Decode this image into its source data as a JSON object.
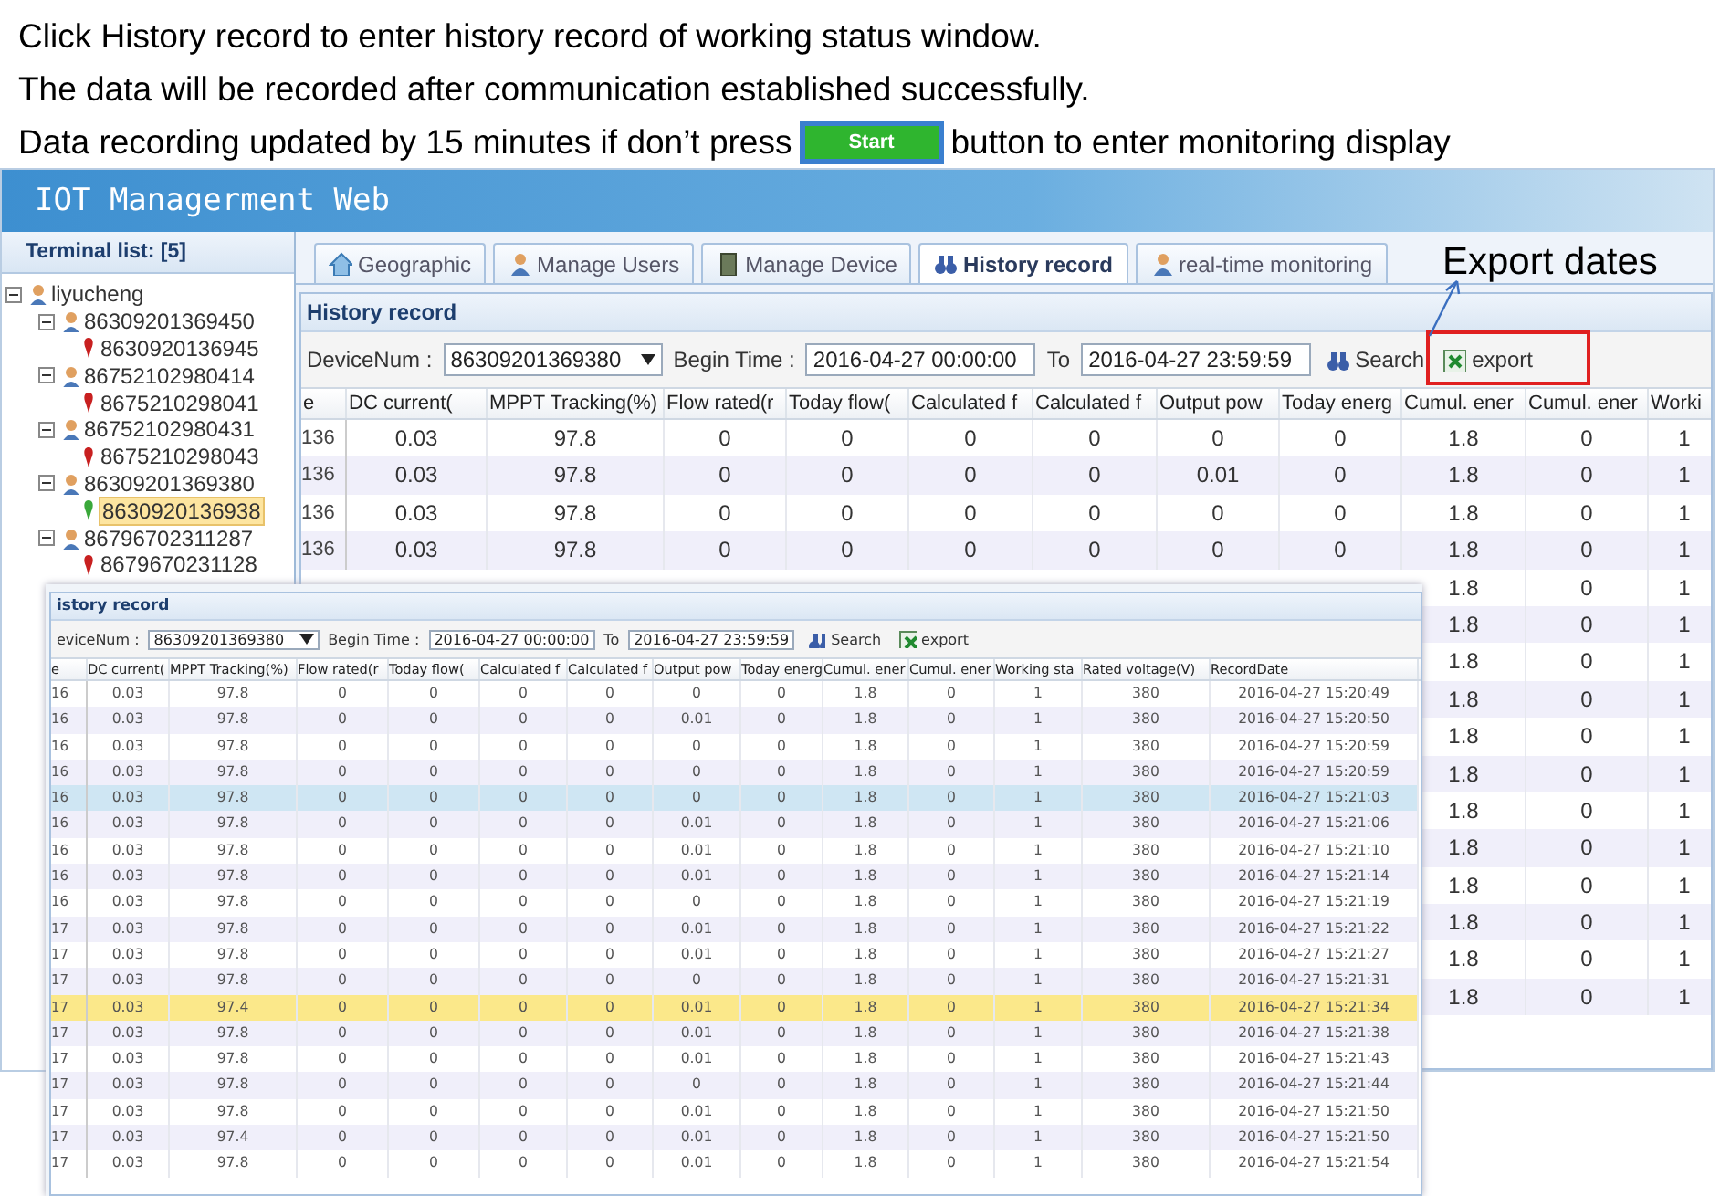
{
  "instructions": [
    {
      "kind": "text",
      "text": "Click History record to enter history record of working status window."
    },
    {
      "kind": "text",
      "text": "The data will be recorded after communication established successfully."
    },
    {
      "kind": "button-line",
      "text": "Data recording updated by 15 minutes if don’t press",
      "button": "Start",
      "after": "button to enter monitoring display"
    }
  ],
  "app": {
    "title": "IOT Managerment Web",
    "sidebar": {
      "title": "Terminal list: [5]",
      "tree": [
        {
          "label": "liyucheng",
          "expanded": true,
          "children": [
            {
              "label": "86309201369450",
              "expanded": true,
              "children": [
                {
                  "label": "8630920136945",
                  "selected": false
                }
              ]
            },
            {
              "label": "86752102980414",
              "expanded": true,
              "children": [
                {
                  "label": "8675210298041",
                  "selected": false
                }
              ]
            },
            {
              "label": "86752102980431",
              "expanded": true,
              "children": [
                {
                  "label": "8675210298043",
                  "selected": false
                }
              ]
            },
            {
              "label": "86309201369380",
              "expanded": true,
              "children": [
                {
                  "label": "8630920136938",
                  "selected": true
                }
              ]
            },
            {
              "label": "86796702311287",
              "expanded": true,
              "children": [
                {
                  "label": "8679670231128",
                  "selected": false
                }
              ]
            }
          ]
        }
      ]
    },
    "tabs": [
      {
        "label": "Geographic",
        "selected": false
      },
      {
        "label": "Manage Users",
        "selected": false
      },
      {
        "label": "Manage Device",
        "selected": false
      },
      {
        "label": "History record",
        "selected": true
      },
      {
        "label": "real-time monitoring",
        "selected": false
      }
    ],
    "panel": {
      "title": "History record",
      "device_label": "DeviceNum :",
      "device": "86309201369380",
      "begin_label": "Begin Time :",
      "begin": "2016-04-27 00:00:00",
      "to_label": "To",
      "end": "2016-04-27 23:59:59",
      "search": "Search",
      "export": "export",
      "columns": [
        "e",
        "DC current(",
        "MPPT Tracking(%)",
        "Flow rated(r",
        "Today flow(",
        "Calculated f",
        "Calculated f",
        "Output pow",
        "Today energ",
        "Cumul. ener",
        "Cumul. ener",
        "Worki"
      ],
      "rows": [
        {
          "selected": false,
          "cells": [
            "136",
            "0.03",
            "97.8",
            "0",
            "0",
            "0",
            "0",
            "0",
            "0",
            "1.8",
            "0",
            "1"
          ]
        },
        {
          "selected": false,
          "cells": [
            "136",
            "0.03",
            "97.8",
            "0",
            "0",
            "0",
            "0",
            "0.01",
            "0",
            "1.8",
            "0",
            "1"
          ]
        },
        {
          "selected": false,
          "cells": [
            "136",
            "0.03",
            "97.8",
            "0",
            "0",
            "0",
            "0",
            "0",
            "0",
            "1.8",
            "0",
            "1"
          ]
        },
        {
          "selected": false,
          "cells": [
            "136",
            "0.03",
            "97.8",
            "0",
            "0",
            "0",
            "0",
            "0",
            "0",
            "1.8",
            "0",
            "1"
          ]
        },
        {
          "selected": false,
          "cells": [
            "1.8",
            "0",
            "1"
          ]
        },
        {
          "selected": false,
          "cells": [
            "1.8",
            "0",
            "1"
          ]
        },
        {
          "selected": false,
          "cells": [
            "1.8",
            "0",
            "1"
          ]
        },
        {
          "selected": false,
          "cells": [
            "1.8",
            "0",
            "1"
          ]
        },
        {
          "selected": false,
          "cells": [
            "1.8",
            "0",
            "1"
          ]
        },
        {
          "selected": false,
          "cells": [
            "1.8",
            "0",
            "1"
          ]
        },
        {
          "selected": false,
          "cells": [
            "1.8",
            "0",
            "1"
          ]
        },
        {
          "selected": false,
          "cells": [
            "1.8",
            "0",
            "1"
          ]
        },
        {
          "selected": false,
          "cells": [
            "1.8",
            "0",
            "1"
          ]
        },
        {
          "selected": false,
          "cells": [
            "1.8",
            "0",
            "1"
          ]
        },
        {
          "selected": false,
          "cells": [
            "1.8",
            "0",
            "1"
          ]
        },
        {
          "selected": false,
          "cells": [
            "1.8",
            "0",
            "1"
          ]
        }
      ]
    }
  },
  "annotation": {
    "text": "Export dates"
  },
  "inset": {
    "title": "istory record",
    "device_label": "eviceNum :",
    "device": "86309201369380",
    "begin_label": "Begin Time :",
    "begin": "2016-04-27 00:00:00",
    "to_label": "To",
    "end": "2016-04-27 23:59:59",
    "search": "Search",
    "export": "export",
    "columns": [
      "e",
      "DC current(",
      "MPPT Tracking(%)",
      "Flow rated(r",
      "Today flow(",
      "Calculated f",
      "Calculated f",
      "Output pow",
      "Today energ",
      "Cumul. ener",
      "Cumul. ener",
      "Working sta",
      "Rated voltage(V)",
      "RecordDate"
    ],
    "rows": [
      {
        "selected": false,
        "highlighted": false,
        "cells": [
          "16",
          "0.03",
          "97.8",
          "0",
          "0",
          "0",
          "0",
          "0",
          "0",
          "1.8",
          "0",
          "1",
          "380",
          "2016-04-27 15:20:49"
        ]
      },
      {
        "selected": false,
        "highlighted": false,
        "cells": [
          "16",
          "0.03",
          "97.8",
          "0",
          "0",
          "0",
          "0",
          "0.01",
          "0",
          "1.8",
          "0",
          "1",
          "380",
          "2016-04-27 15:20:50"
        ]
      },
      {
        "selected": false,
        "highlighted": false,
        "cells": [
          "16",
          "0.03",
          "97.8",
          "0",
          "0",
          "0",
          "0",
          "0",
          "0",
          "1.8",
          "0",
          "1",
          "380",
          "2016-04-27 15:20:59"
        ]
      },
      {
        "selected": false,
        "highlighted": false,
        "cells": [
          "16",
          "0.03",
          "97.8",
          "0",
          "0",
          "0",
          "0",
          "0",
          "0",
          "1.8",
          "0",
          "1",
          "380",
          "2016-04-27 15:20:59"
        ]
      },
      {
        "selected": true,
        "highlighted": false,
        "cells": [
          "16",
          "0.03",
          "97.8",
          "0",
          "0",
          "0",
          "0",
          "0",
          "0",
          "1.8",
          "0",
          "1",
          "380",
          "2016-04-27 15:21:03"
        ]
      },
      {
        "selected": false,
        "highlighted": false,
        "cells": [
          "16",
          "0.03",
          "97.8",
          "0",
          "0",
          "0",
          "0",
          "0.01",
          "0",
          "1.8",
          "0",
          "1",
          "380",
          "2016-04-27 15:21:06"
        ]
      },
      {
        "selected": false,
        "highlighted": false,
        "cells": [
          "16",
          "0.03",
          "97.8",
          "0",
          "0",
          "0",
          "0",
          "0.01",
          "0",
          "1.8",
          "0",
          "1",
          "380",
          "2016-04-27 15:21:10"
        ]
      },
      {
        "selected": false,
        "highlighted": false,
        "cells": [
          "16",
          "0.03",
          "97.8",
          "0",
          "0",
          "0",
          "0",
          "0.01",
          "0",
          "1.8",
          "0",
          "1",
          "380",
          "2016-04-27 15:21:14"
        ]
      },
      {
        "selected": false,
        "highlighted": false,
        "cells": [
          "16",
          "0.03",
          "97.8",
          "0",
          "0",
          "0",
          "0",
          "0",
          "0",
          "1.8",
          "0",
          "1",
          "380",
          "2016-04-27 15:21:19"
        ]
      },
      {
        "selected": false,
        "highlighted": false,
        "cells": [
          "17",
          "0.03",
          "97.8",
          "0",
          "0",
          "0",
          "0",
          "0.01",
          "0",
          "1.8",
          "0",
          "1",
          "380",
          "2016-04-27 15:21:22"
        ]
      },
      {
        "selected": false,
        "highlighted": false,
        "cells": [
          "17",
          "0.03",
          "97.8",
          "0",
          "0",
          "0",
          "0",
          "0.01",
          "0",
          "1.8",
          "0",
          "1",
          "380",
          "2016-04-27 15:21:27"
        ]
      },
      {
        "selected": false,
        "highlighted": false,
        "cells": [
          "17",
          "0.03",
          "97.8",
          "0",
          "0",
          "0",
          "0",
          "0",
          "0",
          "1.8",
          "0",
          "1",
          "380",
          "2016-04-27 15:21:31"
        ]
      },
      {
        "selected": false,
        "highlighted": true,
        "cells": [
          "17",
          "0.03",
          "97.4",
          "0",
          "0",
          "0",
          "0",
          "0.01",
          "0",
          "1.8",
          "0",
          "1",
          "380",
          "2016-04-27 15:21:34"
        ]
      },
      {
        "selected": false,
        "highlighted": false,
        "cells": [
          "17",
          "0.03",
          "97.8",
          "0",
          "0",
          "0",
          "0",
          "0.01",
          "0",
          "1.8",
          "0",
          "1",
          "380",
          "2016-04-27 15:21:38"
        ]
      },
      {
        "selected": false,
        "highlighted": false,
        "cells": [
          "17",
          "0.03",
          "97.8",
          "0",
          "0",
          "0",
          "0",
          "0.01",
          "0",
          "1.8",
          "0",
          "1",
          "380",
          "2016-04-27 15:21:43"
        ]
      },
      {
        "selected": false,
        "highlighted": false,
        "cells": [
          "17",
          "0.03",
          "97.8",
          "0",
          "0",
          "0",
          "0",
          "0",
          "0",
          "1.8",
          "0",
          "1",
          "380",
          "2016-04-27 15:21:44"
        ]
      },
      {
        "selected": false,
        "highlighted": false,
        "cells": [
          "17",
          "0.03",
          "97.8",
          "0",
          "0",
          "0",
          "0",
          "0.01",
          "0",
          "1.8",
          "0",
          "1",
          "380",
          "2016-04-27 15:21:50"
        ]
      },
      {
        "selected": false,
        "highlighted": false,
        "cells": [
          "17",
          "0.03",
          "97.4",
          "0",
          "0",
          "0",
          "0",
          "0.01",
          "0",
          "1.8",
          "0",
          "1",
          "380",
          "2016-04-27 15:21:50"
        ]
      },
      {
        "selected": false,
        "highlighted": false,
        "cells": [
          "17",
          "0.03",
          "97.8",
          "0",
          "0",
          "0",
          "0",
          "0.01",
          "0",
          "1.8",
          "0",
          "1",
          "380",
          "2016-04-27 15:21:54"
        ]
      }
    ]
  }
}
